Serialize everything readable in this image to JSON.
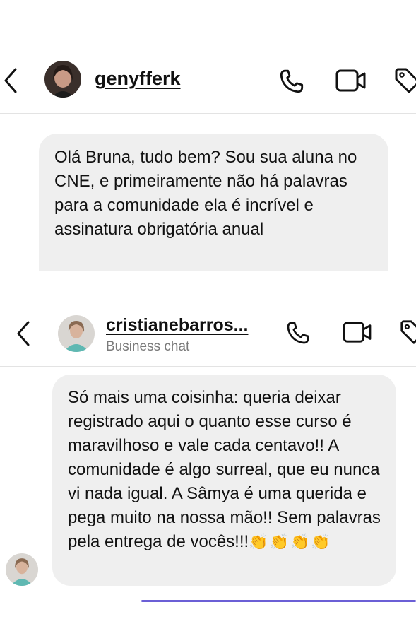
{
  "chat1": {
    "username": "genyfferk",
    "icons": {
      "back": "chevron-left-icon",
      "call": "phone-icon",
      "video": "video-camera-icon",
      "tag": "tag-icon"
    },
    "message": "Olá Bruna, tudo bem? Sou sua aluna no CNE, e primeiramente não há palavras para a comunidade ela é incrível e assinatura obrigatória anual"
  },
  "chat2": {
    "username": "cristianebarros...",
    "subtitle": "Business chat",
    "icons": {
      "back": "chevron-left-icon",
      "call": "phone-icon",
      "video": "video-camera-icon",
      "tag": "tag-icon"
    },
    "message": "Só mais uma coisinha: queria deixar registrado aqui o quanto esse curso é maravilhoso e vale cada centavo!! A comunidade é algo surreal, que eu nunca vi nada igual. A Sâmya é uma querida e pega muito na nossa mão!! Sem palavras pela entrega de vocês!!!",
    "emoji": "👏👏👏👏"
  },
  "colors": {
    "bubble": "#efefef",
    "accent_bar": "#6b5fd6",
    "subtitle": "#7a7a7a"
  }
}
